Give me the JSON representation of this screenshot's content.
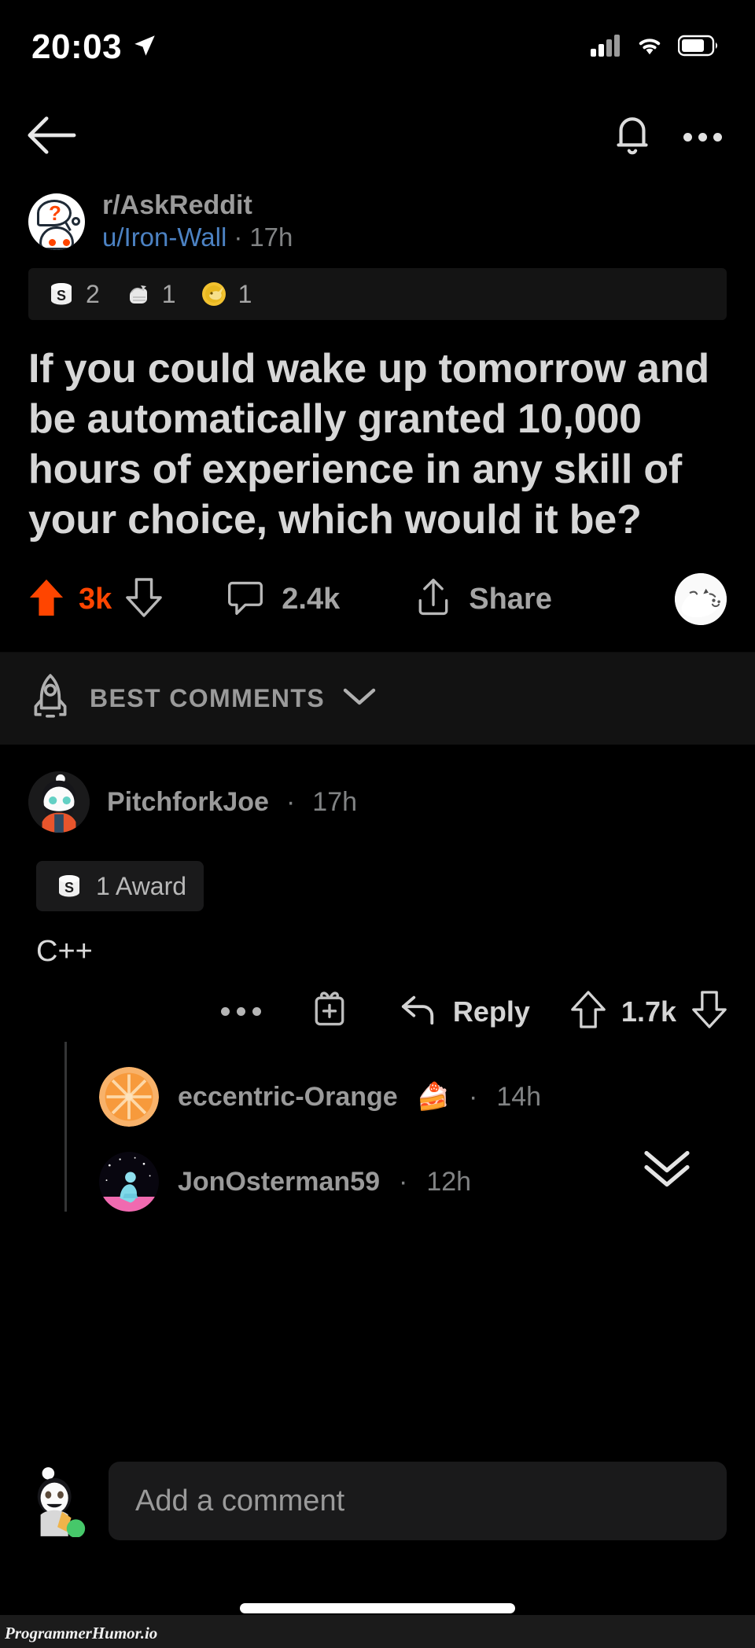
{
  "status_bar": {
    "time": "20:03",
    "location_icon": "location-arrow-icon",
    "signal_icon": "cellular-signal-icon",
    "wifi_icon": "wifi-icon",
    "battery_icon": "battery-icon"
  },
  "navbar": {
    "back_icon": "back-arrow-icon",
    "notifications_icon": "bell-icon",
    "overflow_icon": "more-horizontal-icon"
  },
  "post": {
    "subreddit": "r/AskReddit",
    "author": "u/Iron-Wall",
    "separator": "·",
    "timestamp": "17h",
    "awards": [
      {
        "icon": "silver-award-icon",
        "count": "2"
      },
      {
        "icon": "wholesome-fist-award-icon",
        "count": "1"
      },
      {
        "icon": "gold-narwhal-award-icon",
        "count": "1"
      }
    ],
    "title": "If you could wake up tomorrow and be automatically granted 10,000 hours of experience in any skill of your choice, which would it be?",
    "actions": {
      "upvote_icon": "upvote-arrow-filled-icon",
      "score": "3k",
      "downvote_icon": "downvote-arrow-icon",
      "comment_icon": "comment-bubble-icon",
      "comment_count": "2.4k",
      "share_icon": "share-icon",
      "share_label": "Share",
      "avatar_icon": "cat-avatar-icon"
    }
  },
  "sort_bar": {
    "icon": "rocket-icon",
    "label": "BEST COMMENTS",
    "chevron_icon": "chevron-down-icon"
  },
  "comments": [
    {
      "avatar_icon": "bearded-snoo-avatar-icon",
      "author": "PitchforkJoe",
      "separator": "·",
      "timestamp": "17h",
      "award_badge": {
        "icon": "silver-award-icon",
        "label": "1 Award"
      },
      "body": "C++",
      "actions": {
        "overflow_icon": "more-horizontal-icon",
        "gift_icon": "give-award-icon",
        "reply_icon": "reply-arrow-icon",
        "reply_label": "Reply",
        "upvote_icon": "upvote-arrow-icon",
        "score": "1.7k",
        "downvote_icon": "downvote-arrow-icon"
      }
    }
  ],
  "replies": [
    {
      "avatar_icon": "orange-slice-avatar-icon",
      "author": "eccentric-Orange",
      "cake_icon": "🍰",
      "separator": "·",
      "timestamp": "14h"
    },
    {
      "avatar_icon": "blue-figure-avatar-icon",
      "author": "JonOsterman59",
      "cake_icon": "",
      "separator": "·",
      "timestamp": "12h",
      "expand_icon": "double-chevron-down-icon"
    }
  ],
  "composer": {
    "avatar_icon": "snoo-user-avatar-icon",
    "placeholder": "Add a comment"
  },
  "watermark": "ProgrammerHumor.io",
  "colors": {
    "background": "#000000",
    "upvote_orange": "#ff4500",
    "link_blue": "#4c82c3",
    "muted_text": "#818384",
    "surface": "#1a1a1b"
  }
}
